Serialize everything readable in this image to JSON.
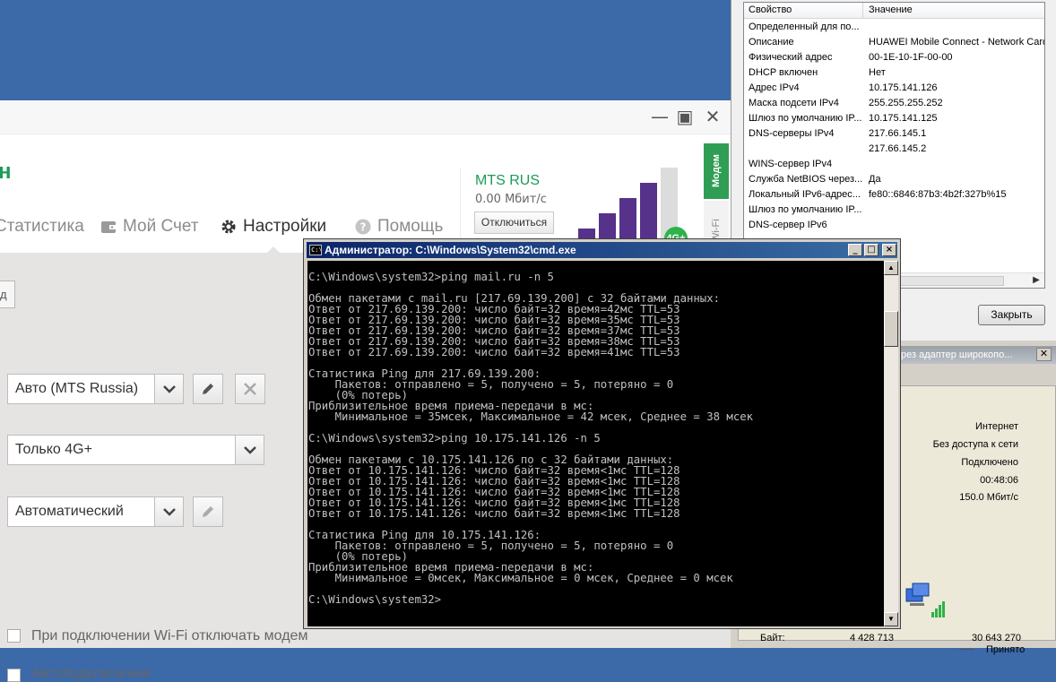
{
  "modem_app": {
    "brand_letter": "н",
    "window_controls": {
      "minimize": "—",
      "maximize": "▣",
      "close": "✕"
    },
    "nav": [
      {
        "label": "Статистика",
        "icon": "statistics-icon"
      },
      {
        "label": "Мой Счет",
        "icon": "wallet-icon"
      },
      {
        "label": "Настройки",
        "icon": "gear-icon",
        "active": true
      },
      {
        "label": "Помощь",
        "icon": "help-icon"
      }
    ],
    "operator": {
      "name": "MTS RUS",
      "speed": "0.00 Мбит/с",
      "disconnect_label": "Отключиться",
      "signal_bars_filled": 4,
      "signal_bars_total": 5,
      "network_badge": "4G+"
    },
    "side_tabs": {
      "modem": "Модем",
      "wifi": "Wi-Fi"
    },
    "settings": {
      "left_button_label": "д",
      "profile_value": "Авто (MTS Russia)",
      "network_mode_value": "Только 4G+",
      "band_value": "Автоматический",
      "autoconnect_label": "Автоподключение",
      "wifi_disconnect_label": "При подключении Wi-Fi отключать модем"
    }
  },
  "net_props": {
    "header_property": "Свойство",
    "header_value": "Значение",
    "rows": [
      {
        "k": "Определенный для по...",
        "v": ""
      },
      {
        "k": "Описание",
        "v": "HUAWEI Mobile Connect - Network Card"
      },
      {
        "k": "Физический адрес",
        "v": "00-1E-10-1F-00-00"
      },
      {
        "k": "DHCP включен",
        "v": "Нет"
      },
      {
        "k": "Адрес IPv4",
        "v": "10.175.141.126"
      },
      {
        "k": "Маска подсети IPv4",
        "v": "255.255.255.252"
      },
      {
        "k": "Шлюз по умолчанию IP...",
        "v": "10.175.141.125"
      },
      {
        "k": "DNS-серверы IPv4",
        "v": "217.66.145.1"
      },
      {
        "k": "",
        "v": "217.66.145.2"
      },
      {
        "k": "WINS-сервер IPv4",
        "v": ""
      },
      {
        "k": "Служба NetBIOS через...",
        "v": "Да"
      },
      {
        "k": "Локальный IPv6-адрес...",
        "v": "fe80::6846:87b3:4b2f:327b%15"
      },
      {
        "k": "Шлюз по умолчанию IP...",
        "v": ""
      },
      {
        "k": "DNS-сервер IPv6",
        "v": ""
      }
    ],
    "close_button": "Закрыть"
  },
  "status_dialog": {
    "title": "рез адаптер широкопо...",
    "close": "✕",
    "rows": [
      "Интернет",
      "Без доступа к сети",
      "Подключено",
      "00:48:06",
      "150.0 Мбит/с"
    ],
    "received_label": "Принято",
    "bytes_label": "Байт:",
    "bytes_sent": "4 428 713",
    "bytes_received": "30 643 270"
  },
  "cmd": {
    "title": "Администратор: C:\\Windows\\System32\\cmd.exe",
    "icon_text": "C:\\",
    "buttons": {
      "minimize": "_",
      "maximize": "□",
      "close": "×"
    },
    "lines": [
      "",
      "C:\\Windows\\system32>ping mail.ru -n 5",
      "",
      "Обмен пакетами с mail.ru [217.69.139.200] с 32 байтами данных:",
      "Ответ от 217.69.139.200: число байт=32 время=42мс TTL=53",
      "Ответ от 217.69.139.200: число байт=32 время=35мс TTL=53",
      "Ответ от 217.69.139.200: число байт=32 время=37мс TTL=53",
      "Ответ от 217.69.139.200: число байт=32 время=38мс TTL=53",
      "Ответ от 217.69.139.200: число байт=32 время=41мс TTL=53",
      "",
      "Статистика Ping для 217.69.139.200:",
      "    Пакетов: отправлено = 5, получено = 5, потеряно = 0",
      "    (0% потерь)",
      "Приблизительное время приема-передачи в мс:",
      "    Минимальное = 35мсек, Максимальное = 42 мсек, Среднее = 38 мсек",
      "",
      "C:\\Windows\\system32>ping 10.175.141.126 -n 5",
      "",
      "Обмен пакетами с 10.175.141.126 по с 32 байтами данных:",
      "Ответ от 10.175.141.126: число байт=32 время<1мс TTL=128",
      "Ответ от 10.175.141.126: число байт=32 время<1мс TTL=128",
      "Ответ от 10.175.141.126: число байт=32 время<1мс TTL=128",
      "Ответ от 10.175.141.126: число байт=32 время<1мс TTL=128",
      "Ответ от 10.175.141.126: число байт=32 время<1мс TTL=128",
      "",
      "Статистика Ping для 10.175.141.126:",
      "    Пакетов: отправлено = 5, получено = 5, потеряно = 0",
      "    (0% потерь)",
      "Приблизительное время приема-передачи в мс:",
      "    Минимальное = 0мсек, Максимальное = 0 мсек, Среднее = 0 мсек",
      "",
      "C:\\Windows\\system32>"
    ]
  },
  "colors": {
    "desktop": "#3c69a8",
    "brand_green": "#1b9b55",
    "signal_purple": "#56328a",
    "cmd_title": "#0a246a",
    "cmd_text": "#c0c0c0"
  }
}
